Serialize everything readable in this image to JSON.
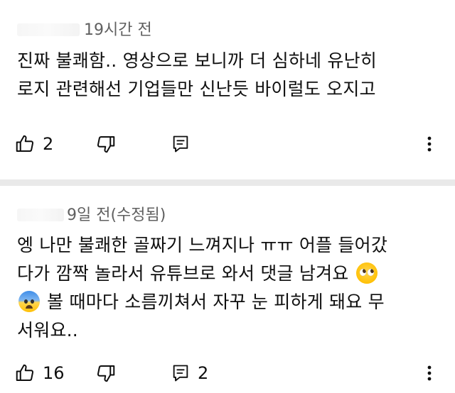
{
  "comments": [
    {
      "time": "19시간 전",
      "lines": [
        "진짜 불쾌함.. 영상으로 보니까 더 심하네 유난히",
        "로지 관련해선 기업들만 신난듯 바이럴도 오지고"
      ],
      "likes": "2",
      "replies": ""
    },
    {
      "time": "9일 전(수정됨)",
      "line1": "엥 나만 불쾌한 골짜기 느껴지나 ㅠㅠ 어플 들어갔",
      "line2": "다가 깜짝 놀라서 유튜브로 와서 댓글 남겨요 ",
      "line3": " 볼 때마다 소름끼쳐서 자꾸 눈 피하게 돼요 무",
      "line4": "서워요..",
      "emoji_a": "pleading-face-emoji",
      "emoji_b": "anxious-face-with-sweat-emoji",
      "likes": "16",
      "replies": "2"
    }
  ],
  "icons": {
    "like": "thumbs-up-icon",
    "dislike": "thumbs-down-icon",
    "reply": "reply-comment-icon",
    "more": "more-vertical-icon"
  }
}
